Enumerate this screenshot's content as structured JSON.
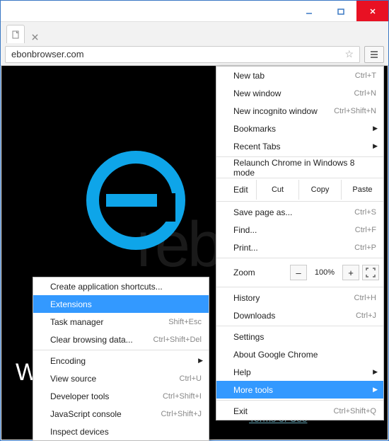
{
  "url": "ebonbrowser.com",
  "brand_text": "WSER",
  "terms_link": "Terms of Use",
  "watermark": "rebo",
  "menu": {
    "new_tab": {
      "label": "New tab",
      "shortcut": "Ctrl+T"
    },
    "new_window": {
      "label": "New window",
      "shortcut": "Ctrl+N"
    },
    "incognito": {
      "label": "New incognito window",
      "shortcut": "Ctrl+Shift+N"
    },
    "bookmarks": {
      "label": "Bookmarks"
    },
    "recent_tabs": {
      "label": "Recent Tabs"
    },
    "relaunch": {
      "label": "Relaunch Chrome in Windows 8 mode"
    },
    "edit": {
      "label": "Edit",
      "cut": "Cut",
      "copy": "Copy",
      "paste": "Paste"
    },
    "save_as": {
      "label": "Save page as...",
      "shortcut": "Ctrl+S"
    },
    "find": {
      "label": "Find...",
      "shortcut": "Ctrl+F"
    },
    "print": {
      "label": "Print...",
      "shortcut": "Ctrl+P"
    },
    "zoom": {
      "label": "Zoom",
      "minus": "–",
      "value": "100%",
      "plus": "+"
    },
    "history": {
      "label": "History",
      "shortcut": "Ctrl+H"
    },
    "downloads": {
      "label": "Downloads",
      "shortcut": "Ctrl+J"
    },
    "settings": {
      "label": "Settings"
    },
    "about": {
      "label": "About Google Chrome"
    },
    "help": {
      "label": "Help"
    },
    "more_tools": {
      "label": "More tools"
    },
    "exit": {
      "label": "Exit",
      "shortcut": "Ctrl+Shift+Q"
    }
  },
  "submenu": {
    "create_shortcuts": {
      "label": "Create application shortcuts..."
    },
    "extensions": {
      "label": "Extensions"
    },
    "task_manager": {
      "label": "Task manager",
      "shortcut": "Shift+Esc"
    },
    "clear_data": {
      "label": "Clear browsing data...",
      "shortcut": "Ctrl+Shift+Del"
    },
    "encoding": {
      "label": "Encoding"
    },
    "view_source": {
      "label": "View source",
      "shortcut": "Ctrl+U"
    },
    "dev_tools": {
      "label": "Developer tools",
      "shortcut": "Ctrl+Shift+I"
    },
    "js_console": {
      "label": "JavaScript console",
      "shortcut": "Ctrl+Shift+J"
    },
    "inspect": {
      "label": "Inspect devices"
    }
  }
}
